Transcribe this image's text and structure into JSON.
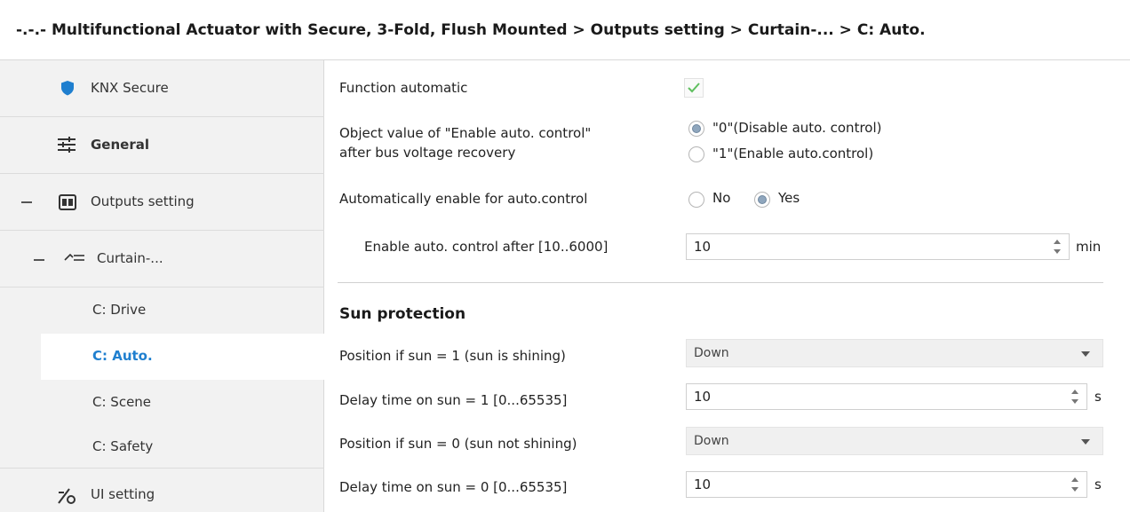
{
  "breadcrumb": "-.-.- Multifunctional Actuator with Secure, 3-Fold, Flush Mounted > Outputs setting > Curtain-... > C: Auto.",
  "sidebar": {
    "items": [
      {
        "label": "KNX Secure",
        "icon": "shield-icon"
      },
      {
        "label": "General",
        "icon": "sliders-icon"
      },
      {
        "label": "Outputs setting",
        "icon": "outputs-icon",
        "expanded": true
      },
      {
        "label": "Curtain-...",
        "icon": "curtain-icon",
        "expanded": true
      },
      {
        "label": "C: Drive"
      },
      {
        "label": "C: Auto.",
        "selected": true
      },
      {
        "label": "C: Scene"
      },
      {
        "label": "C: Safety"
      },
      {
        "label": "UI setting",
        "icon": "ui-setting-icon"
      }
    ]
  },
  "main": {
    "function_automatic": {
      "label": "Function automatic",
      "checked": true
    },
    "object_value": {
      "label_line1": "Object value of \"Enable auto. control\"",
      "label_line2": "after bus voltage recovery",
      "options": [
        "\"0\"(Disable auto. control)",
        "\"1\"(Enable auto.control)"
      ],
      "selected": 0
    },
    "auto_enable": {
      "label": "Automatically enable for auto.control",
      "options": [
        "No",
        "Yes"
      ],
      "selected": 1
    },
    "enable_after": {
      "label": "Enable auto. control after [10..6000]",
      "value": "10",
      "unit": "min"
    },
    "sun_protection": {
      "title": "Sun protection",
      "position_sun1": {
        "label": "Position if sun = 1  (sun is shining)",
        "value": "Down"
      },
      "delay_sun1": {
        "label": "Delay time on sun = 1  [0...65535]",
        "value": "10",
        "unit": "s"
      },
      "position_sun0": {
        "label": "Position if sun = 0  (sun not shining)",
        "value": "Down"
      },
      "delay_sun0": {
        "label": "Delay time on sun = 0  [0...65535]",
        "value": "10",
        "unit": "s"
      }
    }
  },
  "colors": {
    "accent": "#1f7fcf",
    "sidebar_bg": "#f2f2f2",
    "check": "#5fbf5f"
  }
}
